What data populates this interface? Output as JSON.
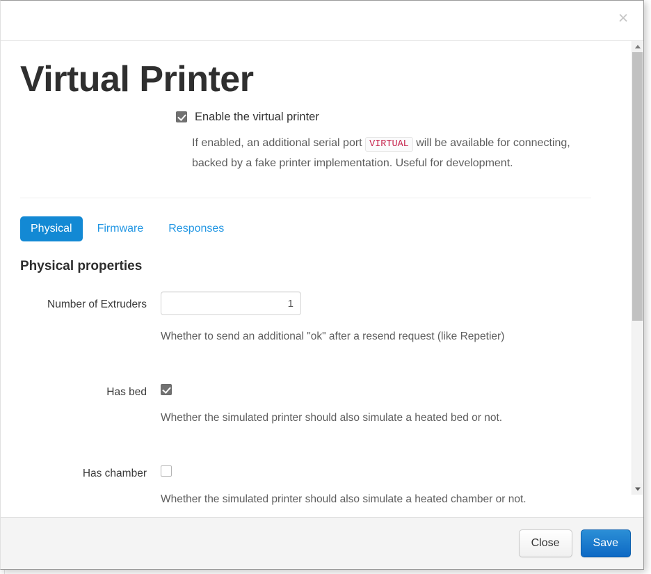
{
  "modal": {
    "close_icon_label": "×",
    "title": "Virtual Printer",
    "enable": {
      "label": "Enable the virtual printer",
      "checked": true,
      "help_before": "If enabled, an additional serial port",
      "help_code": "VIRTUAL",
      "help_after": "will be available for connecting, backed by a fake printer implementation. Useful for development."
    },
    "tabs": [
      {
        "label": "Physical",
        "active": true
      },
      {
        "label": "Firmware",
        "active": false
      },
      {
        "label": "Responses",
        "active": false
      }
    ],
    "section_heading": "Physical properties",
    "fields": [
      {
        "label": "Number of Extruders",
        "type": "number",
        "value": "1",
        "placeholder": "",
        "help": "Whether to send an additional \"ok\" after a resend request (like Repetier)"
      },
      {
        "label": "Has bed",
        "type": "checkbox",
        "checked": true,
        "help": "Whether the simulated printer should also simulate a heated bed or not."
      },
      {
        "label": "Has chamber",
        "type": "checkbox",
        "checked": false,
        "help": "Whether the simulated printer should also simulate a heated chamber or not."
      }
    ],
    "footer": {
      "close_label": "Close",
      "save_label": "Save"
    }
  },
  "colors": {
    "tab_active_bg": "#1389d4",
    "tab_link": "#2196e3",
    "primary_button": "#0d69c4",
    "code_text": "#c7254e",
    "title_text": "#2f2f2f"
  }
}
